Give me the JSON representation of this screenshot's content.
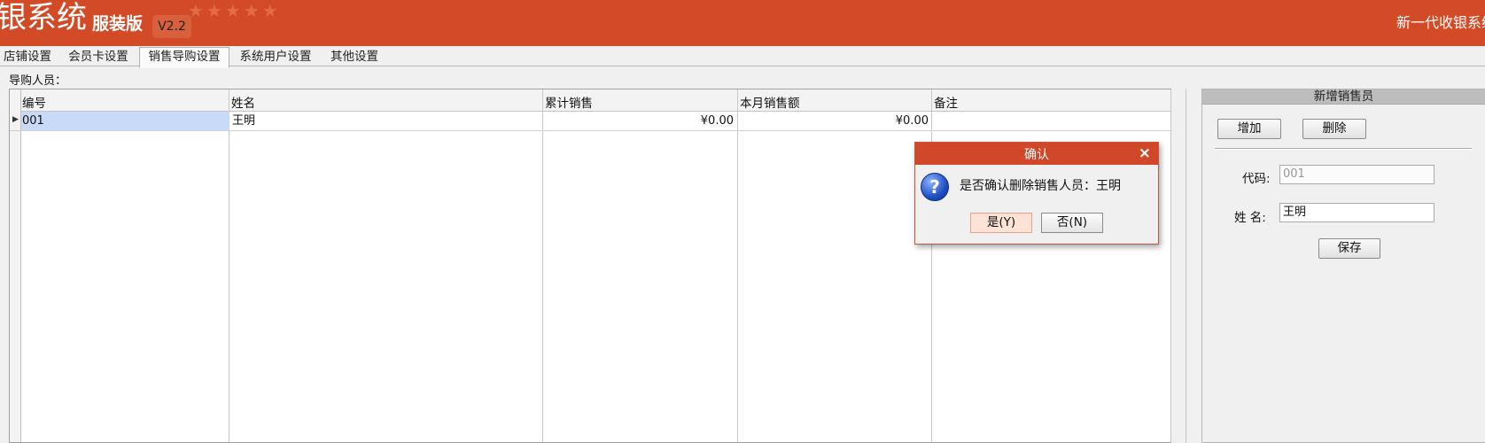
{
  "header": {
    "brand_big": "银系统",
    "brand_small": "服装版",
    "version": "V2.2",
    "stars": "★★★★★",
    "right_text": "新一代收银系统"
  },
  "tabs": [
    {
      "label": "店铺设置"
    },
    {
      "label": "会员卡设置"
    },
    {
      "label": "销售导购设置"
    },
    {
      "label": "系统用户设置"
    },
    {
      "label": "其他设置"
    }
  ],
  "guide_label": "导购人员：",
  "grid": {
    "columns": [
      "编号",
      "姓名",
      "累计销售",
      "本月销售额",
      "备注"
    ],
    "rows": [
      {
        "code": "001",
        "name": "王明",
        "total_sales": "¥0.00",
        "month_sales": "¥0.00",
        "note": ""
      }
    ]
  },
  "panel": {
    "title": "新增销售员",
    "add_label": "增加",
    "delete_label": "删除",
    "code_label": "代码:",
    "code_value": "001",
    "name_label": "姓 名:",
    "name_value": "王明",
    "save_label": "保存"
  },
  "dialog": {
    "title": "确认",
    "close": "×",
    "message": "是否确认删除销售人员：王明",
    "yes_label": "是(Y)",
    "no_label": "否(N)"
  },
  "colors": {
    "header_bg": "#d24a26",
    "selection": "#c9d9f8"
  }
}
